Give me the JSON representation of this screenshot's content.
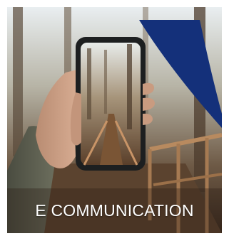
{
  "banner": {
    "caption": "E COMMUNICATION",
    "accent_color": "#14307a"
  }
}
